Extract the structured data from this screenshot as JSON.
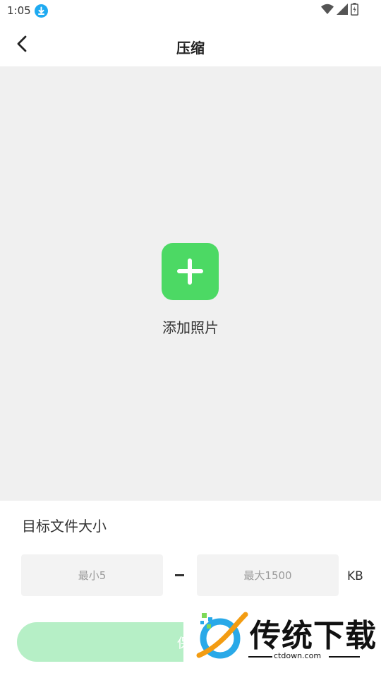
{
  "status_bar": {
    "time": "1:05",
    "download_icon": "download-arrow-icon",
    "icons": [
      "wifi-icon",
      "cellular-signal-icon",
      "battery-charging-icon"
    ]
  },
  "header": {
    "back_icon": "chevron-left-icon",
    "title": "压缩"
  },
  "photo_area": {
    "add_icon": "plus-icon",
    "add_label": "添加照片",
    "accent_color": "#4cd964"
  },
  "target_size": {
    "title": "目标文件大小",
    "min_placeholder": "最小5",
    "max_placeholder": "最大1500",
    "unit": "KB"
  },
  "save_button": {
    "label": "保存",
    "color": "#b6efc6"
  },
  "watermark": {
    "brand": "传统下载",
    "url": "ctdown.com"
  }
}
